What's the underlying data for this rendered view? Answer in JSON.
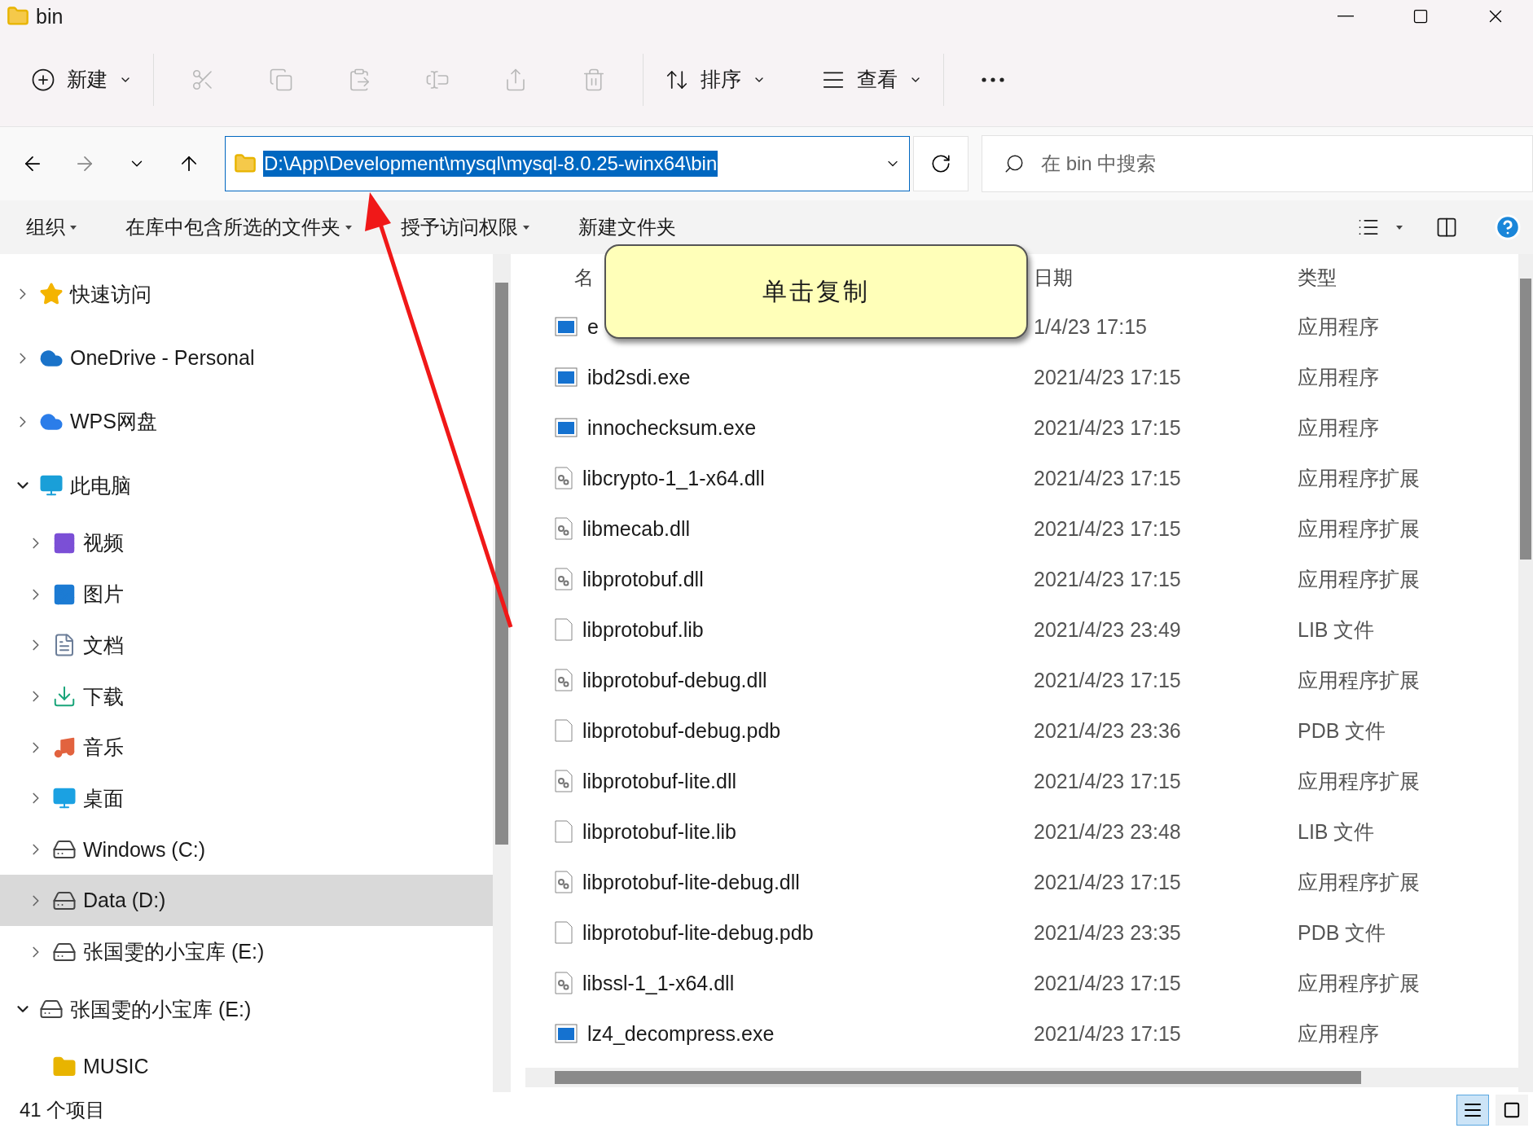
{
  "window": {
    "title": "bin"
  },
  "toolbar": {
    "new_button": "新建",
    "edit_actions_disabled": true,
    "sort_button": "排序",
    "view_button": "查看"
  },
  "address": {
    "path": "D:\\App\\Development\\mysql\\mysql-8.0.25-winx64\\bin",
    "selected": true
  },
  "search": {
    "placeholder": "在 bin 中搜索"
  },
  "commands": [
    {
      "label": "组织",
      "dropdown": true
    },
    {
      "label": "在库中包含所选的文件夹",
      "dropdown": true
    },
    {
      "label": "授予访问权限",
      "dropdown": true
    },
    {
      "label": "新建文件夹",
      "dropdown": false
    }
  ],
  "sidebar": {
    "items": [
      {
        "kind": "star",
        "label": "快速访问",
        "expandable": true,
        "expanded": false,
        "selected": false
      },
      {
        "kind": "cloud",
        "label": "OneDrive - Personal",
        "expandable": true,
        "expanded": false,
        "selected": false
      },
      {
        "kind": "wps-cloud",
        "label": "WPS网盘",
        "expandable": true,
        "expanded": false,
        "selected": false
      },
      {
        "kind": "pc",
        "label": "此电脑",
        "expandable": true,
        "expanded": true,
        "selected": false,
        "children": [
          {
            "kind": "video",
            "label": "视频",
            "expandable": true,
            "expanded": false,
            "selected": false
          },
          {
            "kind": "picture",
            "label": "图片",
            "expandable": true,
            "expanded": false,
            "selected": false
          },
          {
            "kind": "doc",
            "label": "文档",
            "expandable": true,
            "expanded": false,
            "selected": false
          },
          {
            "kind": "download",
            "label": "下载",
            "expandable": true,
            "expanded": false,
            "selected": false
          },
          {
            "kind": "music",
            "label": "音乐",
            "expandable": true,
            "expanded": false,
            "selected": false
          },
          {
            "kind": "desktop",
            "label": "桌面",
            "expandable": true,
            "expanded": false,
            "selected": false
          },
          {
            "kind": "system-drive",
            "label": "Windows (C:)",
            "expandable": true,
            "expanded": false,
            "selected": false
          },
          {
            "kind": "drive",
            "label": "Data (D:)",
            "expandable": true,
            "expanded": false,
            "selected": true
          },
          {
            "kind": "drive",
            "label": "张国雯的小宝库 (E:)",
            "expandable": true,
            "expanded": false,
            "selected": false
          }
        ]
      },
      {
        "kind": "drive",
        "label": "张国雯的小宝库 (E:)",
        "expandable": true,
        "expanded": true,
        "selected": false,
        "children": [
          {
            "kind": "folder",
            "label": "MUSIC",
            "expandable": false,
            "expanded": false,
            "selected": false
          }
        ]
      }
    ]
  },
  "files": {
    "columns": [
      {
        "label": "名"
      },
      {
        "label": "日期"
      },
      {
        "label": "类型"
      }
    ],
    "rows": [
      {
        "kind": "exe",
        "name": "e",
        "date": "1/4/23 17:15",
        "type": "应用程序"
      },
      {
        "kind": "exe",
        "name": "ibd2sdi.exe",
        "date": "2021/4/23 17:15",
        "type": "应用程序"
      },
      {
        "kind": "exe",
        "name": "innochecksum.exe",
        "date": "2021/4/23 17:15",
        "type": "应用程序"
      },
      {
        "kind": "dll",
        "name": "libcrypto-1_1-x64.dll",
        "date": "2021/4/23 17:15",
        "type": "应用程序扩展"
      },
      {
        "kind": "dll",
        "name": "libmecab.dll",
        "date": "2021/4/23 17:15",
        "type": "应用程序扩展"
      },
      {
        "kind": "dll",
        "name": "libprotobuf.dll",
        "date": "2021/4/23 17:15",
        "type": "应用程序扩展"
      },
      {
        "kind": "file",
        "name": "libprotobuf.lib",
        "date": "2021/4/23 23:49",
        "type": "LIB 文件"
      },
      {
        "kind": "dll",
        "name": "libprotobuf-debug.dll",
        "date": "2021/4/23 17:15",
        "type": "应用程序扩展"
      },
      {
        "kind": "file",
        "name": "libprotobuf-debug.pdb",
        "date": "2021/4/23 23:36",
        "type": "PDB 文件"
      },
      {
        "kind": "dll",
        "name": "libprotobuf-lite.dll",
        "date": "2021/4/23 17:15",
        "type": "应用程序扩展"
      },
      {
        "kind": "file",
        "name": "libprotobuf-lite.lib",
        "date": "2021/4/23 23:48",
        "type": "LIB 文件"
      },
      {
        "kind": "dll",
        "name": "libprotobuf-lite-debug.dll",
        "date": "2021/4/23 17:15",
        "type": "应用程序扩展"
      },
      {
        "kind": "file",
        "name": "libprotobuf-lite-debug.pdb",
        "date": "2021/4/23 23:35",
        "type": "PDB 文件"
      },
      {
        "kind": "dll",
        "name": "libssl-1_1-x64.dll",
        "date": "2021/4/23 17:15",
        "type": "应用程序扩展"
      },
      {
        "kind": "exe",
        "name": "lz4_decompress.exe",
        "date": "2021/4/23 17:15",
        "type": "应用程序"
      }
    ]
  },
  "callout": {
    "text": "单击复制"
  },
  "status_bar": {
    "count": "41 个项目",
    "view_modes": [
      {
        "selected": true
      },
      {
        "selected": false
      }
    ]
  }
}
